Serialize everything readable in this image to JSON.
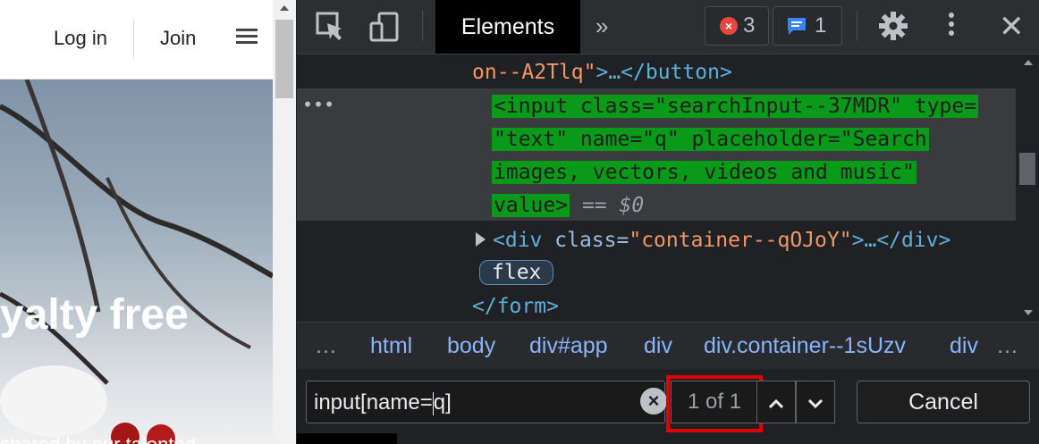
{
  "page": {
    "nav": {
      "login": "Log in",
      "join": "Join"
    },
    "hero": {
      "title_partial": "yalty free",
      "subtitle_partial": "shared by our talented"
    }
  },
  "devtools": {
    "active_tab": "Elements",
    "errors_count": "3",
    "messages_count": "1",
    "dom_lines": {
      "l1_val": "on--A2Tlq\"",
      "l1_rest": ">…</button>",
      "sel1": "<input class=\"searchInput--37MDR\" type=",
      "sel2": "\"text\" name=\"q\" placeholder=\"Search",
      "sel3": "images, vectors, videos and music\"",
      "sel4": "value>",
      "sel_eq": " == $0",
      "div_open": "<div ",
      "div_attr": "class=",
      "div_val": "\"container--qOJoY\"",
      "div_close": ">…</div>",
      "flex_badge": "flex",
      "form_close": "</form>"
    },
    "breadcrumbs": [
      "html",
      "body",
      "div#app",
      "div",
      "div.container--1sUzv",
      "div"
    ],
    "search": {
      "query_before_caret": "input[name=",
      "query_after_caret": "q]",
      "match_count": "1 of 1",
      "cancel_label": "Cancel"
    }
  }
}
